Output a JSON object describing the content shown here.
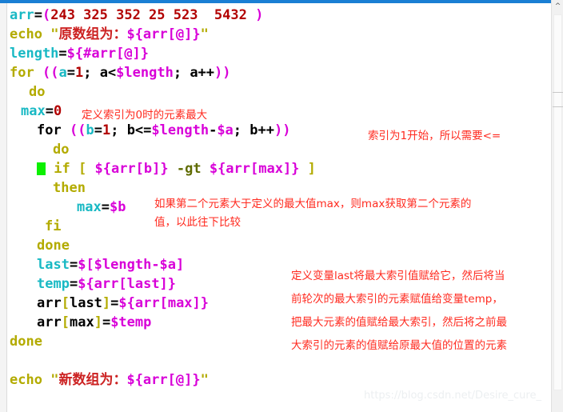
{
  "editor": {
    "language": "bash",
    "colors": {
      "variable": "#19b9c4",
      "keyword": "#b3ab00",
      "number": "#b20000",
      "punctuation": "#d800d8",
      "string": "#cc2222",
      "operator": "#5f6b00",
      "plain": "#000000",
      "cursor": "#0cf000",
      "annotation": "#ff2a1f",
      "accent_bar": "#1a7fd4",
      "background": "#ffffff"
    },
    "lines": [
      {
        "indent": 0,
        "text": "arr=(243 325 352 25 523  5432 )"
      },
      {
        "indent": 0,
        "text": "echo \"原数组为：${arr[@]}\""
      },
      {
        "indent": 0,
        "text": "length=${#arr[@]}"
      },
      {
        "indent": 0,
        "text": "for ((a=1; a<$length; a++))"
      },
      {
        "indent": 2,
        "text": "do"
      },
      {
        "indent": 2,
        "text": "max=0"
      },
      {
        "indent": 3,
        "text": "for ((b=1; b<=$length-$a; b++))"
      },
      {
        "indent": 5,
        "text": "do"
      },
      {
        "indent": 4,
        "text": "if [ ${arr[b]} -gt ${arr[max]} ]"
      },
      {
        "indent": 5,
        "text": "then"
      },
      {
        "indent": 7,
        "text": "max=$b"
      },
      {
        "indent": 4,
        "text": "fi"
      },
      {
        "indent": 3,
        "text": "done"
      },
      {
        "indent": 3,
        "text": "last=$[$length-$a]"
      },
      {
        "indent": 3,
        "text": "temp=${arr[last]}"
      },
      {
        "indent": 3,
        "text": "arr[last]=${arr[max]}"
      },
      {
        "indent": 3,
        "text": "arr[max]=$temp"
      },
      {
        "indent": 0,
        "text": "done"
      },
      {
        "indent": 0,
        "text": ""
      },
      {
        "indent": 0,
        "text": "echo \"新数组为：${arr[@]}\""
      }
    ],
    "cursor": {
      "line_index": 8,
      "symbol": "block-cursor"
    }
  },
  "code_tokens": {
    "line1": {
      "name": "arr",
      "eq": "=",
      "open": "(",
      "values": "243 325 352 25 523  5432 ",
      "close": ")"
    },
    "line2": {
      "kw": "echo",
      "quote": "\"",
      "cn": "原数组为：",
      "expr": "${arr[@]}"
    },
    "line3": {
      "name": "length",
      "eq": "=",
      "expr": "${#arr[@]}"
    },
    "line4": {
      "kw": "for",
      "open": "((",
      "v": "a",
      "eq": "=",
      "num": "1",
      "semi": "; ",
      "cond": "a<",
      "len": "$length",
      "semi2": "; ",
      "inc": "a++",
      "close": "))"
    },
    "line5": {
      "kw": "do"
    },
    "line6": {
      "name": "max",
      "eq": "=",
      "num": "0"
    },
    "line7": {
      "kw": "for",
      "open": "((",
      "v": "b",
      "eq": "=",
      "num": "1",
      "cond": "b<=",
      "len": "$length",
      "minus": "-",
      "a": "$a",
      "inc": "b++",
      "close": "))"
    },
    "line8": {
      "kw": "do"
    },
    "line9": {
      "kw": "if",
      "lb": "[",
      "e1": "${arr[b]}",
      "op": "-gt",
      "e2": "${arr[max]}",
      "rb": "]"
    },
    "line10": {
      "kw": "then"
    },
    "line11": {
      "name": "max",
      "eq": "=",
      "val": "$b"
    },
    "line12": {
      "kw": "fi"
    },
    "line13": {
      "kw": "done"
    },
    "line14": {
      "name": "last",
      "eq": "=",
      "expr": "$[$length-$a]"
    },
    "line15": {
      "name": "temp",
      "eq": "=",
      "expr": "${arr[last]}"
    },
    "line16": {
      "name": "arr",
      "lb": "[",
      "idx": "last",
      "rb": "]",
      "eq": "=",
      "expr": "${arr[max]}"
    },
    "line17": {
      "name": "arr",
      "lb": "[",
      "idx": "max",
      "rb": "]",
      "eq": "=",
      "expr": "$temp"
    },
    "line18": {
      "kw": "done"
    },
    "line20": {
      "kw": "echo",
      "quote": "\"",
      "cn": "新数组为：",
      "expr": "${arr[@]}"
    }
  },
  "annotations": [
    {
      "id": "note-max-init",
      "text": "定义索引为0时的元素最大"
    },
    {
      "id": "note-index-start",
      "text": "索引为1开始，所以需要<="
    },
    {
      "id": "note-if-compare-1",
      "text": "如果第二个元素大于定义的最大值max，则max获取第二个元素的"
    },
    {
      "id": "note-if-compare-2",
      "text": "值，以此往下比较"
    },
    {
      "id": "note-swap-1",
      "text": "定义变量last将最大索引值赋给它，然后将当"
    },
    {
      "id": "note-swap-2",
      "text": "前轮次的最大索引的元素赋值给变量temp，"
    },
    {
      "id": "note-swap-3",
      "text": "把最大元素的值赋给最大索引，然后将之前最"
    },
    {
      "id": "note-swap-4",
      "text": "大索引的元素的值赋给原最大值的位置的元素"
    }
  ],
  "watermark": {
    "text": "https://blog.csdn.net/Desire_cure_"
  },
  "scrollbar": {
    "up_arrow": "chevron-up-icon",
    "position": "top"
  }
}
